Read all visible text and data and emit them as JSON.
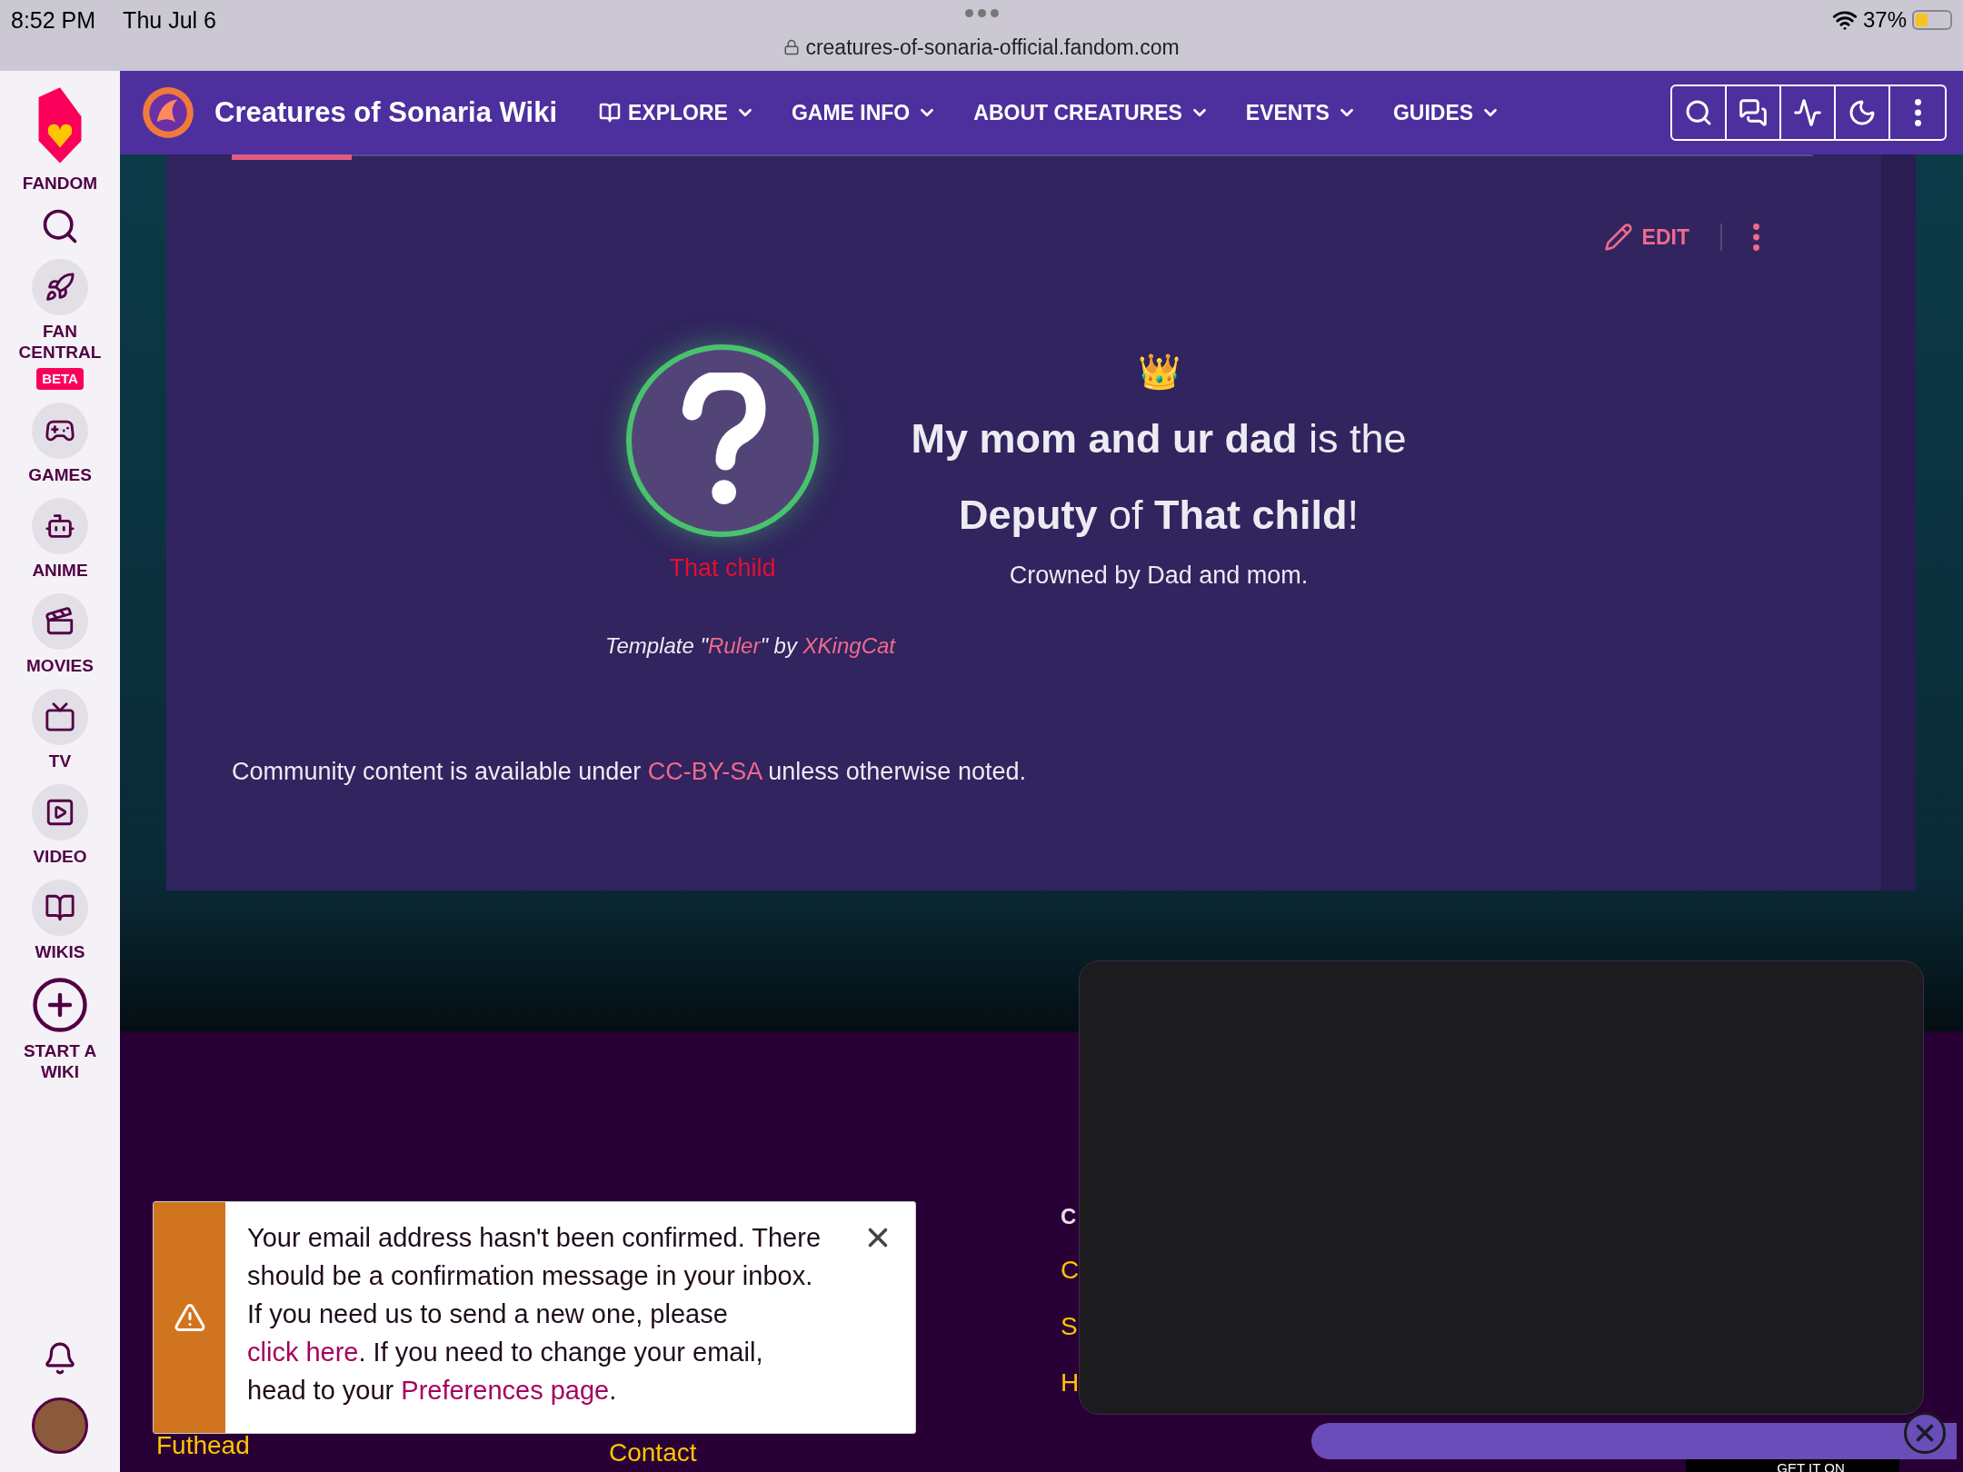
{
  "status_bar": {
    "time": "8:52 PM",
    "date": "Thu Jul 6",
    "url": "creatures-of-sonaria-official.fandom.com",
    "battery": "37%"
  },
  "sidebar": {
    "logo_label": "FANDOM",
    "items": [
      {
        "label": "FAN CENTRAL",
        "badge": "BETA"
      },
      {
        "label": "GAMES"
      },
      {
        "label": "ANIME"
      },
      {
        "label": "MOVIES"
      },
      {
        "label": "TV"
      },
      {
        "label": "VIDEO"
      },
      {
        "label": "WIKIS"
      },
      {
        "label": "START A WIKI",
        "kind": "add"
      }
    ]
  },
  "nav": {
    "title": "Creatures of Sonaria Wiki",
    "menus": [
      "EXPLORE",
      "GAME INFO",
      "ABOUT CREATURES",
      "EVENTS",
      "GUIDES"
    ]
  },
  "article": {
    "edit": "EDIT",
    "ruler": {
      "name": "That child",
      "title_lines": [
        "**My mom and ur dad** is the",
        "**Deputy** of **That child**!"
      ],
      "subtitle": "Crowned by Dad and mom.",
      "crown": "👑"
    },
    "template": {
      "before": "Template \"",
      "name": "Ruler",
      "middle": "\" by ",
      "author": "XKingCat"
    },
    "license": {
      "before": "Community content is available under ",
      "link": "CC-BY-SA",
      "after": " unless otherwise noted."
    }
  },
  "footer": {
    "left_links": [
      "Futhead"
    ],
    "middle_links": [
      "Contact"
    ],
    "right_heading": "C",
    "right_links": [
      "C",
      "S",
      "H"
    ],
    "store_badge": "GET IT ON"
  },
  "notification": {
    "lines": [
      "Your email address hasn't been confirmed. There should be a confirmation message in your inbox. If you need us to send a new one, please ",
      "click here",
      ". If you need to change your email, head to your ",
      "Preferences page",
      "."
    ]
  }
}
